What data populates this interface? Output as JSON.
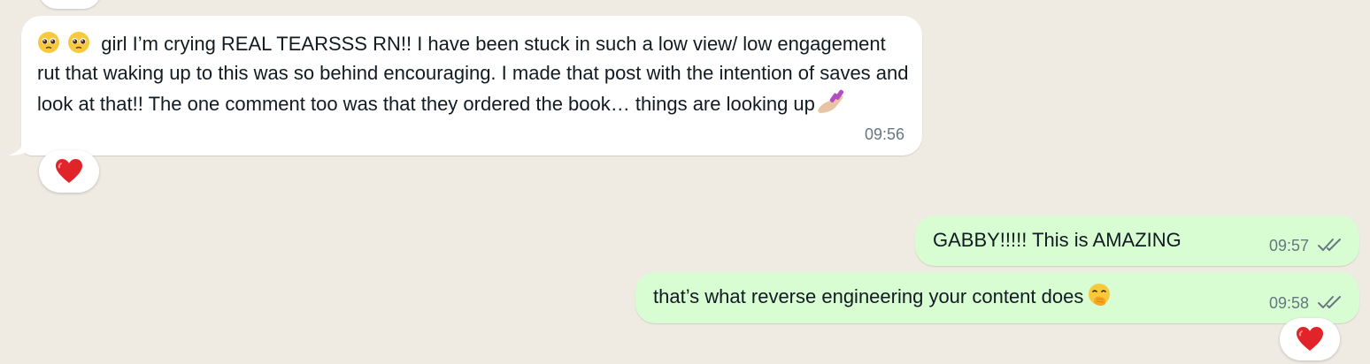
{
  "conversation": {
    "messages": [
      {
        "direction": "incoming",
        "text": "girl I’m crying REAL TEARSSS RN!! I have been stuck in such a low view/ low engagement rut that waking up to this was so behind encouraging. I made that post with the intention of saves and look at that!! The one comment too was that they ordered the book… things are looking up",
        "leading_emojis": [
          "pleading-face",
          "pleading-face"
        ],
        "trailing_emoji": "nail-polish",
        "time": "09:56",
        "reaction": "heart"
      },
      {
        "direction": "outgoing",
        "text": "GABBY!!!!! This is AMAZING",
        "time": "09:57",
        "status": "read-double-tick"
      },
      {
        "direction": "outgoing",
        "text": "that’s what reverse engineering your content does",
        "trailing_emoji": "face-with-hand-over-mouth",
        "time": "09:58",
        "status": "read-double-tick",
        "reaction": "heart"
      }
    ]
  },
  "theme": {
    "background": "#efeae2",
    "incoming_bubble": "#ffffff",
    "outgoing_bubble": "#d9fdd3",
    "timestamp": "#667781",
    "reaction_heart": "#e0242a"
  }
}
